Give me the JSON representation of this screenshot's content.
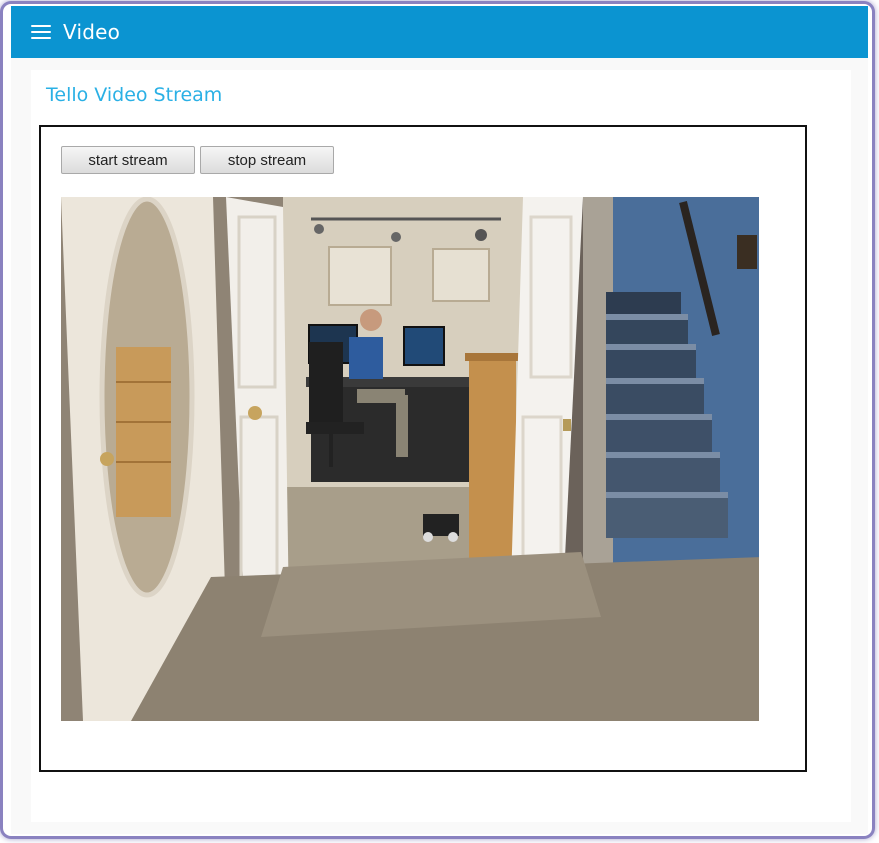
{
  "app": {
    "title": "Video"
  },
  "page": {
    "heading": "Tello Video Stream"
  },
  "controls": {
    "start_label": "start stream",
    "stop_label": "stop stream"
  },
  "colors": {
    "topbar": "#0b94d1",
    "heading": "#2ab0e5"
  },
  "icons": {
    "menu": "hamburger-menu-icon"
  },
  "video": {
    "content": "live-video-frame"
  }
}
